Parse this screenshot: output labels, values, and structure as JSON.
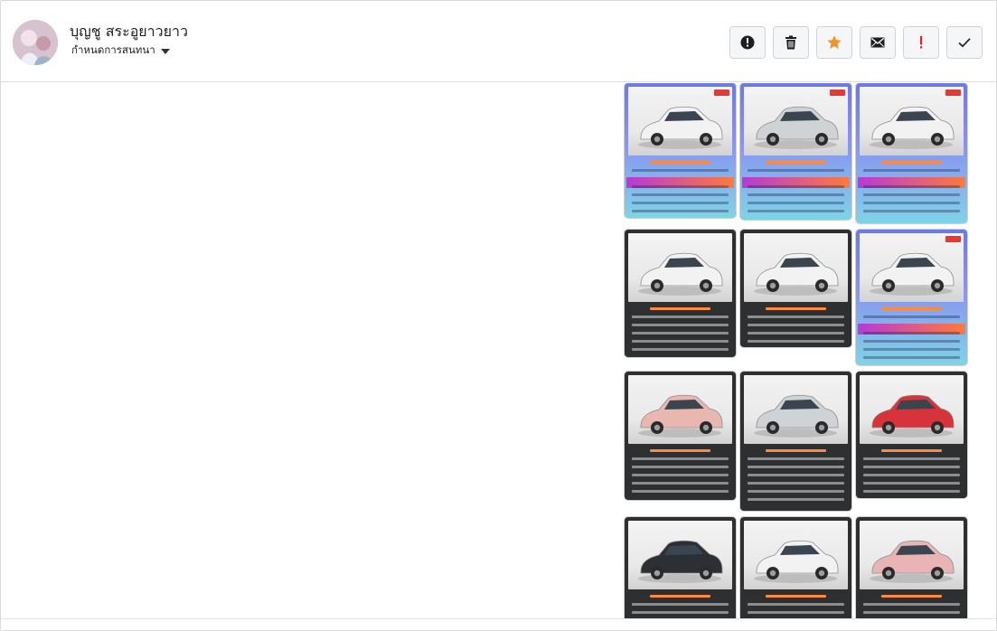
{
  "header": {
    "contact_name": "บุญชู สระอูยาวยาว",
    "assign_label": "กำหนดการสนทนา"
  },
  "actions": [
    {
      "icon": "alert-circle-icon",
      "color": "#1c1e21"
    },
    {
      "icon": "trash-icon",
      "color": "#1c1e21"
    },
    {
      "icon": "star-icon",
      "color": "#f0932b"
    },
    {
      "icon": "envelope-icon",
      "color": "#1c1e21"
    },
    {
      "icon": "exclamation-icon",
      "color": "#e02424"
    },
    {
      "icon": "check-icon",
      "color": "#1c1e21"
    }
  ],
  "cards": [
    {
      "style": "promo",
      "car": "#f2f2f2"
    },
    {
      "style": "promo",
      "car": "#cfd3d6"
    },
    {
      "style": "promo",
      "car": "#f2f2f2"
    },
    {
      "style": "dark",
      "car": "#f2f2f2"
    },
    {
      "style": "dark",
      "car": "#f2f2f2"
    },
    {
      "style": "promo",
      "car": "#f2f2f2"
    },
    {
      "style": "dark",
      "car": "#e8b7b0"
    },
    {
      "style": "dark",
      "car": "#cfd3d6"
    },
    {
      "style": "dark",
      "car": "#d8323a"
    },
    {
      "style": "dark",
      "car": "#2c2f33"
    },
    {
      "style": "dark",
      "car": "#f2f2f2"
    },
    {
      "style": "dark",
      "car": "#e8b4b4"
    }
  ]
}
